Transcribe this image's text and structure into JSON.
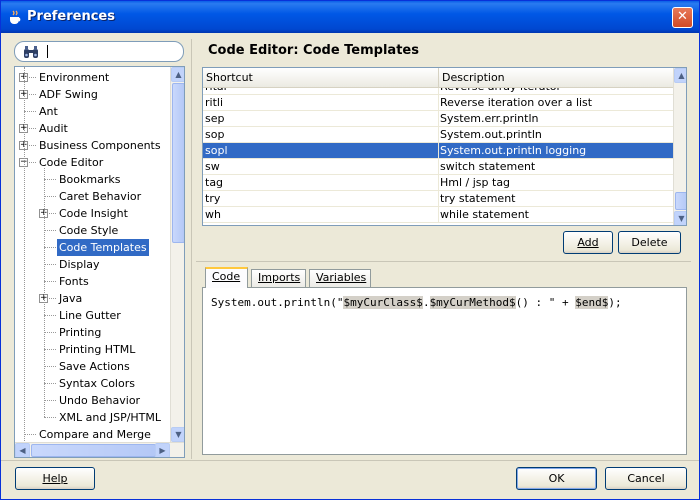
{
  "window": {
    "title": "Preferences",
    "close_label": "✕"
  },
  "search": {
    "value": ""
  },
  "tree": {
    "items": [
      {
        "label": "Environment",
        "level": 0,
        "expander": "+"
      },
      {
        "label": "ADF Swing",
        "level": 0,
        "expander": "+"
      },
      {
        "label": "Ant",
        "level": 0,
        "expander": ""
      },
      {
        "label": "Audit",
        "level": 0,
        "expander": "+"
      },
      {
        "label": "Business Components",
        "level": 0,
        "expander": "+"
      },
      {
        "label": "Code Editor",
        "level": 0,
        "expander": "−"
      },
      {
        "label": "Bookmarks",
        "level": 1,
        "expander": ""
      },
      {
        "label": "Caret Behavior",
        "level": 1,
        "expander": ""
      },
      {
        "label": "Code Insight",
        "level": 1,
        "expander": "+"
      },
      {
        "label": "Code Style",
        "level": 1,
        "expander": ""
      },
      {
        "label": "Code Templates",
        "level": 1,
        "expander": "",
        "selected": true
      },
      {
        "label": "Display",
        "level": 1,
        "expander": ""
      },
      {
        "label": "Fonts",
        "level": 1,
        "expander": ""
      },
      {
        "label": "Java",
        "level": 1,
        "expander": "+"
      },
      {
        "label": "Line Gutter",
        "level": 1,
        "expander": ""
      },
      {
        "label": "Printing",
        "level": 1,
        "expander": ""
      },
      {
        "label": "Printing HTML",
        "level": 1,
        "expander": ""
      },
      {
        "label": "Save Actions",
        "level": 1,
        "expander": ""
      },
      {
        "label": "Syntax Colors",
        "level": 1,
        "expander": ""
      },
      {
        "label": "Undo Behavior",
        "level": 1,
        "expander": ""
      },
      {
        "label": "XML and JSP/HTML",
        "level": 1,
        "expander": ""
      },
      {
        "label": "Compare and Merge",
        "level": 0,
        "expander": ""
      }
    ]
  },
  "main": {
    "title": "Code Editor: Code Templates",
    "table": {
      "columns": [
        "Shortcut",
        "Description"
      ],
      "rows": [
        {
          "shortcut": "ritar",
          "description": "Reverse array iterator",
          "partial": true
        },
        {
          "shortcut": "ritli",
          "description": "Reverse iteration over a list"
        },
        {
          "shortcut": "sep",
          "description": "System.err.println"
        },
        {
          "shortcut": "sop",
          "description": "System.out.println"
        },
        {
          "shortcut": "sopl",
          "description": "System.out.println logging",
          "selected": true
        },
        {
          "shortcut": "sw",
          "description": "switch statement"
        },
        {
          "shortcut": "tag",
          "description": "Hml / jsp tag"
        },
        {
          "shortcut": "try",
          "description": "try statement"
        },
        {
          "shortcut": "wh",
          "description": "while statement"
        }
      ]
    },
    "add_label": "Add",
    "delete_label": "Delete",
    "tabs": [
      {
        "label": "Code",
        "active": true
      },
      {
        "label": "Imports"
      },
      {
        "label": "Variables"
      }
    ],
    "code": {
      "prefix": "System.out.println(\"",
      "var1": "$myCurClass$",
      "dot": ".",
      "var2": "$myCurMethod$",
      "middle": "() : \" + ",
      "var3": "$end$",
      "suffix": ");"
    }
  },
  "footer": {
    "help_label": "Help",
    "ok_label": "OK",
    "cancel_label": "Cancel"
  }
}
